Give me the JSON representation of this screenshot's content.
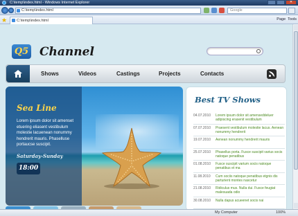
{
  "browser": {
    "window_title": "C:\\temp\\index.html - Windows Internet Explorer",
    "url": "C:\\temp\\index.html",
    "search_placeholder": "Google",
    "tab_label": "C:\\temp\\index.html",
    "toolbar_items": [
      "Page",
      "Tools"
    ],
    "status_zone": "My Computer",
    "zoom": "100%"
  },
  "site": {
    "logo_badge": "Q5",
    "logo_text": "Channel",
    "menu": [
      "Shows",
      "Videos",
      "Castings",
      "Projects",
      "Contacts"
    ]
  },
  "hero": {
    "title": "Sea Line",
    "text": "Lorem ipsum dolor sit amenset etuering eliasent vestibulum molestie lacuenean nonummy hendrerit mauris. Phaselluse portaucse suscipit.",
    "days": "Saturday-Sunday",
    "time": "18:00"
  },
  "shows": {
    "title": "Best TV Shows",
    "items": [
      {
        "date": "04.07.2010",
        "text": "Lorem ipsum dolor sit amenseddeluer adipiscing erasenit vestibulum"
      },
      {
        "date": "07.07.2010",
        "text": "Praesent vestibulum molestie lacus. Aenean nonummy hendrerit"
      },
      {
        "date": "19.07.2010",
        "text": "Aenean nonummy hendrerit mauris"
      },
      {
        "date": "25.07.2010",
        "text": "Phasellus porta. Fusce suscipit varius socis natoque penatibus"
      },
      {
        "date": "01.08.2010",
        "text": "Fusce suscipit varium socis natoque penatibus et ma"
      },
      {
        "date": "11.08.2010",
        "text": "Cum sociis natoque penatibus etgnis dis parturient montes nascetur"
      },
      {
        "date": "21.08.2010",
        "text": "Ridiculus mus. Nulla dui. Fusce feugiat malesuada odio"
      },
      {
        "date": "30.08.2010",
        "text": "Nulla dapus acueenet socis nai"
      }
    ]
  },
  "colors": {
    "accent": "#205f86",
    "link_green": "#4c8b22",
    "logo_yellow": "#ffd54a",
    "menu_dark": "#18405f"
  }
}
